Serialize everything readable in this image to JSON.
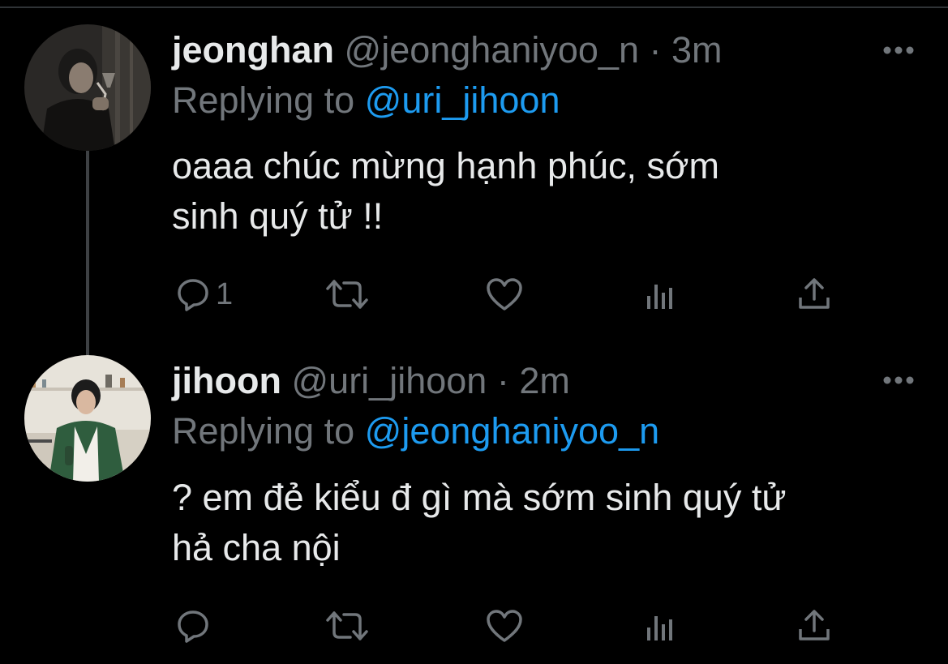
{
  "colors": {
    "background": "#000000",
    "text": "#e7e9ea",
    "muted": "#71767b",
    "link": "#1d9bf0",
    "thread_line": "#3e4144"
  },
  "tweets": [
    {
      "name": "jeonghan",
      "handle": "@jeonghaniyoo_n",
      "separator": "·",
      "time": "3m",
      "replying_prefix": "Replying to",
      "replying_to": "@uri_jihoon",
      "text_line1": "oaaa chúc mừng hạnh phúc, sớm",
      "text_line2": "sinh quý tử !!",
      "reply_count": "1",
      "icons": [
        "reply-icon",
        "retweet-icon",
        "like-icon",
        "analytics-icon",
        "share-icon",
        "more-icon"
      ]
    },
    {
      "name": "jihoon",
      "handle": "@uri_jihoon",
      "separator": "·",
      "time": "2m",
      "replying_prefix": "Replying to",
      "replying_to": "@jeonghaniyoo_n",
      "text_line1": "? em đẻ kiểu đ gì mà sớm sinh quý tử",
      "text_line2": "hả cha nội",
      "reply_count": "",
      "icons": [
        "reply-icon",
        "retweet-icon",
        "like-icon",
        "analytics-icon",
        "share-icon",
        "more-icon"
      ]
    }
  ]
}
